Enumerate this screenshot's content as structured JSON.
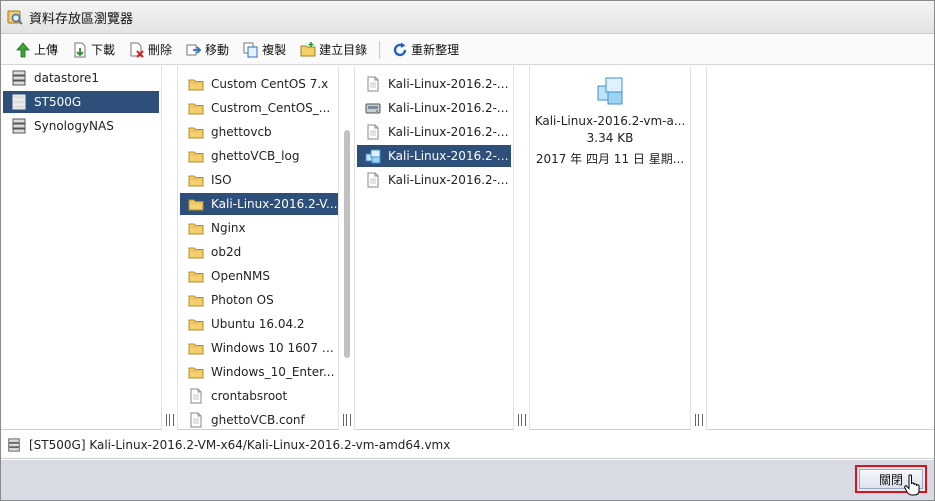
{
  "window": {
    "title": "資料存放區瀏覽器",
    "title_icon": "datastore-browser-icon"
  },
  "toolbar": {
    "upload": "上傳",
    "download": "下載",
    "delete": "刪除",
    "move": "移動",
    "copy": "複製",
    "new_folder": "建立目錄",
    "refresh": "重新整理"
  },
  "datastores": [
    {
      "label": "datastore1",
      "selected": false
    },
    {
      "label": "ST500G",
      "selected": true
    },
    {
      "label": "SynologyNAS",
      "selected": false
    }
  ],
  "folders": [
    {
      "label": "Custom CentOS 7.x",
      "type": "folder",
      "selected": false
    },
    {
      "label": "Custrom_CentOS_...",
      "type": "folder",
      "selected": false
    },
    {
      "label": "ghettovcb",
      "type": "folder",
      "selected": false
    },
    {
      "label": "ghettoVCB_log",
      "type": "folder",
      "selected": false
    },
    {
      "label": "ISO",
      "type": "folder",
      "selected": false
    },
    {
      "label": "Kali-Linux-2016.2-V...",
      "type": "folder",
      "selected": true
    },
    {
      "label": "Nginx",
      "type": "folder",
      "selected": false
    },
    {
      "label": "ob2d",
      "type": "folder",
      "selected": false
    },
    {
      "label": "OpenNMS",
      "type": "folder",
      "selected": false
    },
    {
      "label": "Photon OS",
      "type": "folder",
      "selected": false
    },
    {
      "label": "Ubuntu 16.04.2",
      "type": "folder",
      "selected": false
    },
    {
      "label": "Windows 10 1607 1...",
      "type": "folder",
      "selected": false
    },
    {
      "label": "Windows_10_Enter...",
      "type": "folder",
      "selected": false
    },
    {
      "label": "crontabsroot",
      "type": "file",
      "selected": false
    },
    {
      "label": "ghettoVCB.conf",
      "type": "file",
      "selected": false
    }
  ],
  "files": [
    {
      "label": "Kali-Linux-2016.2-v...",
      "type": "file",
      "selected": false
    },
    {
      "label": "Kali-Linux-2016.2-v...",
      "type": "disk",
      "selected": false
    },
    {
      "label": "Kali-Linux-2016.2-v...",
      "type": "file",
      "selected": false
    },
    {
      "label": "Kali-Linux-2016.2-v...",
      "type": "vmx",
      "selected": true
    },
    {
      "label": "Kali-Linux-2016.2-v...",
      "type": "file",
      "selected": false
    }
  ],
  "preview": {
    "name": "Kali-Linux-2016.2-vm-a...",
    "size": "3.34 KB",
    "date": "2017 年 四月 11 日 星期..."
  },
  "path": {
    "text": "[ST500G] Kali-Linux-2016.2-VM-x64/Kali-Linux-2016.2-vm-amd64.vmx"
  },
  "footer": {
    "close": "關閉"
  },
  "colors": {
    "selection": "#2e4f7a",
    "footer_bg": "#d8dbe3",
    "close_highlight": "#e0101b"
  }
}
